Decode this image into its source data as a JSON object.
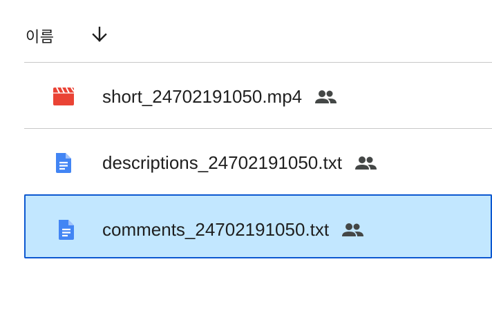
{
  "header": {
    "name_label": "이름",
    "sort_icon": "arrow-down-icon"
  },
  "files": [
    {
      "name": "short_24702191050.mp4",
      "type_icon": "video-file-icon",
      "shared_icon": "shared-people-icon",
      "selected": false
    },
    {
      "name": "descriptions_24702191050.txt",
      "type_icon": "document-file-icon",
      "shared_icon": "shared-people-icon",
      "selected": false
    },
    {
      "name": "comments_24702191050.txt",
      "type_icon": "document-file-icon",
      "shared_icon": "shared-people-icon",
      "selected": true
    }
  ],
  "colors": {
    "video_icon": "#ea4335",
    "document_icon": "#4285f4",
    "selected_background": "#c2e7ff",
    "selected_border": "#0b57d0",
    "divider": "#c7c7c7",
    "text": "#1f1f1f",
    "shared_icon": "#444746"
  }
}
